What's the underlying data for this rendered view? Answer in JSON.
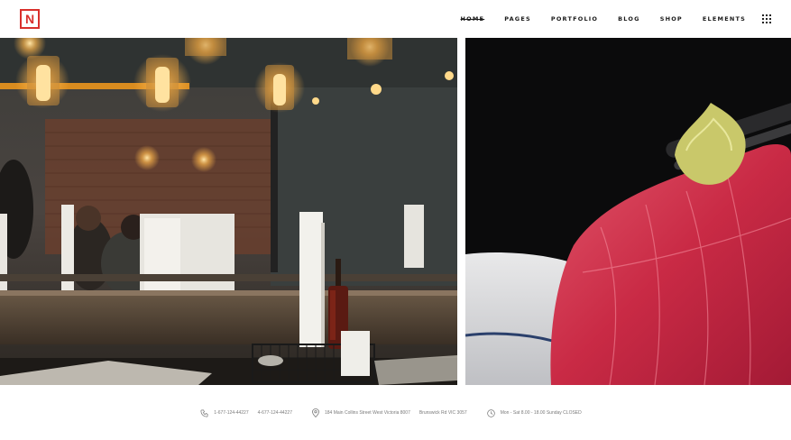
{
  "header": {
    "logo_letter": "N",
    "nav": [
      {
        "label": "HOME",
        "active": true
      },
      {
        "label": "PAGES",
        "active": false
      },
      {
        "label": "PORTFOLIO",
        "active": false
      },
      {
        "label": "BLOG",
        "active": false
      },
      {
        "label": "SHOP",
        "active": false
      },
      {
        "label": "ELEMENTS",
        "active": false
      }
    ],
    "menu_icon": "grid-menu-icon",
    "brand_color": "#d9302c"
  },
  "footer": {
    "phone_1": "1-677-124-44227",
    "phone_2": "4-677-124-44227",
    "address_1": "184 Main Collins Street West Victoria 8007",
    "address_2": "Brunswick Rd VIC 3057",
    "hours": "Mon - Sat 8.00 - 18.00 Sunday CLOSED"
  }
}
